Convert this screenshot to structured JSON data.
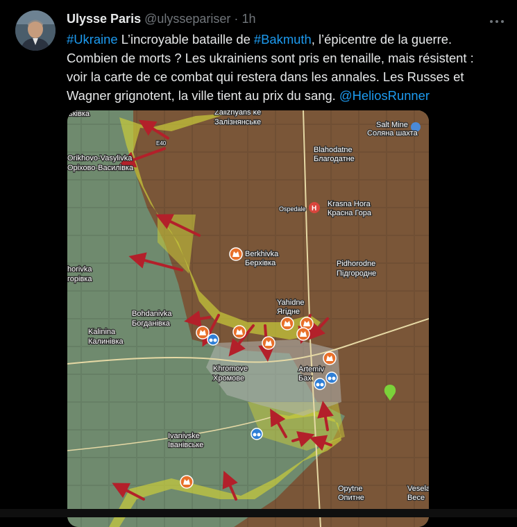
{
  "tweet": {
    "author_name": "Ulysse Paris",
    "author_handle": "@ulyssepariser",
    "separator": "·",
    "time": "1h",
    "text_parts": {
      "hashtag1": "#Ukraine",
      "t1": " L’incroyable bataille de ",
      "hashtag2": "#Bakmuth",
      "t2": ", l’épicentre de la guerre.",
      "line2": "Combien de morts ? Les ukrainiens sont pris en tenaille, mais résistent :",
      "line3": "voir la carte de ce combat qui restera dans les annales. Les Russes et",
      "line4_text": "Wagner grignotent, la ville tient au prix du sang. ",
      "mention": "@HeliosRunner"
    }
  },
  "icons": {
    "more": "more-options-icon",
    "hospital": "hospital-icon",
    "fortification": "fortification-icon",
    "binoculars": "binoculars-icon",
    "pin": "location-pin-icon"
  },
  "map": {
    "labels": {
      "zaliznyanske_lat": "Zaliznyans ke",
      "zaliznyanske_cyr": "Залізнянське",
      "salt_mine_lat": "Salt Mine",
      "salt_mine_cyr": "Соляна шахта",
      "e40": "E40",
      "orikhovo_lat": "Orikhovo-Vasylivka",
      "orikhovo_cyr": "Оріхово-Василівка",
      "blahodatne_lat": "Blahodatne",
      "blahodatne_cyr": "Благодатне",
      "ospedale": "Ospedale",
      "krasna_lat": "Krasna Hora",
      "krasna_cyr": "Красна Гора",
      "berkhivka_lat": "Berkhivka",
      "berkhivka_cyr": "Берхівка",
      "khorivka_lat": "horivka",
      "khorivka_cyr": "горівка",
      "pidhorodne_lat": "Pidhorodne",
      "pidhorodne_cyr": "Підгородне",
      "yahidne_lat": "Yahidne",
      "yahidne_cyr": "Ягідне",
      "bohdanivka_lat": "Bohdanivka",
      "bohdanivka_cyr": "Богданівка",
      "kalinina_lat": "Kalinina",
      "kalinina_cyr": "Калинівка",
      "khromove_lat": "Khromove",
      "khromove_cyr": "Хромове",
      "artemivsk_lat": "Artemiv",
      "artemivsk_cyr": "Бах",
      "ivanivske_lat": "Ivanivske",
      "ivanivske_cyr": "Іванівське",
      "opytne_lat": "Opytne",
      "opytne_cyr": "Опитне",
      "vesela_lat": "Vesela",
      "vesela_cyr": "Весе",
      "top_left": "ьківка"
    },
    "colors": {
      "occupied": "#7a5638",
      "contested": "#c9cc3a",
      "free": "#6f8a6e",
      "arrow": "#b3202a",
      "icon_orange": "#e8702a",
      "icon_blue": "#2f7fd6",
      "pin": "#7bd23a"
    }
  }
}
